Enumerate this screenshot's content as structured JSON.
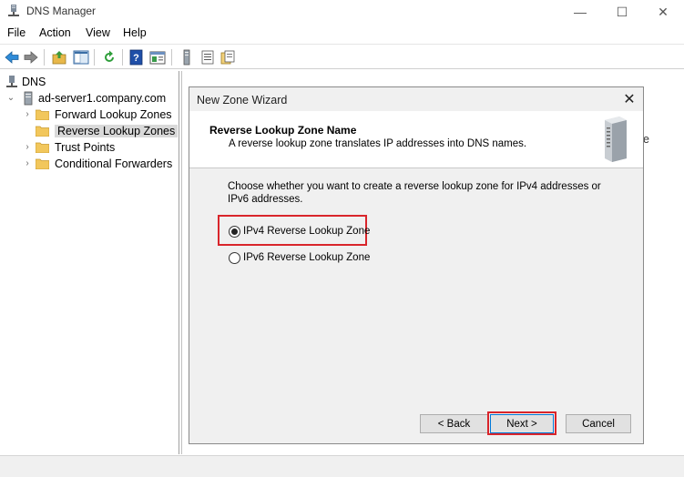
{
  "window": {
    "title": "DNS Manager",
    "min": "—",
    "max": "☐",
    "close": "✕"
  },
  "menu": [
    {
      "label": "File"
    },
    {
      "label": "Action"
    },
    {
      "label": "View"
    },
    {
      "label": "Help"
    }
  ],
  "toolbar": {
    "icons": [
      "back-arrow-icon",
      "forward-arrow-icon",
      "up-folder-icon",
      "show-hide-tree-icon",
      "refresh-icon",
      "help-icon",
      "properties-icon",
      "server-icon",
      "list-icon",
      "export-icon"
    ]
  },
  "tree": {
    "root": {
      "label": "DNS"
    },
    "server": {
      "label": "ad-server1.company.com"
    },
    "items": [
      {
        "label": "Forward Lookup Zones",
        "selected": false
      },
      {
        "label": "Reverse Lookup Zones",
        "selected": true
      },
      {
        "label": "Trust Points",
        "selected": false
      },
      {
        "label": "Conditional Forwarders",
        "selected": false
      }
    ]
  },
  "right_peek": "e",
  "dialog": {
    "title": "New Zone Wizard",
    "header_title": "Reverse Lookup Zone Name",
    "header_subtitle": "A reverse lookup zone translates IP addresses into DNS names.",
    "body_text": "Choose whether you want to create a reverse lookup zone for IPv4 addresses or IPv6 addresses.",
    "options": [
      {
        "label": "IPv4 Reverse Lookup Zone",
        "checked": true
      },
      {
        "label": "IPv6 Reverse Lookup Zone",
        "checked": false
      }
    ],
    "buttons": {
      "back": "< Back",
      "next": "Next >",
      "cancel": "Cancel"
    }
  },
  "colors": {
    "highlight": "#d9252b",
    "selection": "#d9d9d9",
    "dialog_bg": "#f0f0f0",
    "folder": "#f2c75c"
  }
}
